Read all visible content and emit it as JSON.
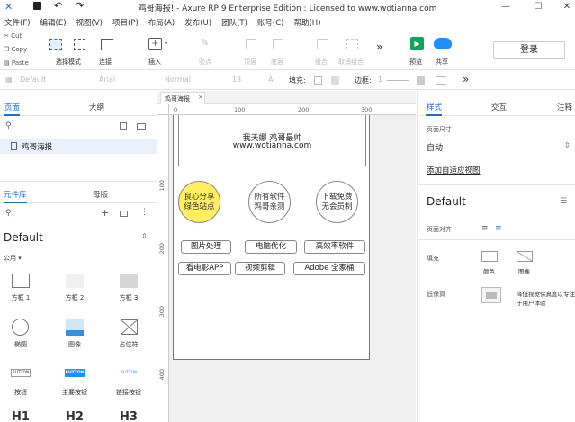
{
  "title_bar": {
    "title": "鸡哥海报! - Axure RP 9 Enterprise Edition : Licensed to www.wotianna.com",
    "minimize": "—",
    "maximize": "☐",
    "close": "✕"
  },
  "menu": [
    "文件(F)",
    "编辑(E)",
    "视图(V)",
    "项目(P)",
    "布局(A)",
    "发布(U)",
    "团队(T)",
    "账号(C)",
    "帮助(H)"
  ],
  "clipboard": {
    "cut": "Cut",
    "copy": "Copy",
    "paste": "Paste"
  },
  "toolbar": {
    "select_mode": "选择模式",
    "connect": "连接",
    "insert": "插入",
    "point": "验点",
    "top": "顶层",
    "bottom": "底层",
    "group": "组合",
    "ungroup": "取消组合",
    "more": "»",
    "preview": "预览",
    "share": "共享",
    "login": "登录"
  },
  "format_bar": {
    "style": "Default",
    "font": "Arial",
    "weight": "Normal",
    "size": "13",
    "fill_label": "填充:",
    "border_label": "边框:",
    "border_value": "1",
    "more": "»"
  },
  "pages_panel": {
    "tabs": [
      "页面",
      "大纲"
    ],
    "page_item": "鸡哥海报"
  },
  "library_panel": {
    "tabs": [
      "元件库",
      "母版"
    ],
    "library_name": "Default",
    "category": "公用 ▾",
    "items": [
      {
        "label": "方框 1"
      },
      {
        "label": "方框 2"
      },
      {
        "label": "方框 3"
      },
      {
        "label": "椭圆"
      },
      {
        "label": "图像"
      },
      {
        "label": "占位符"
      },
      {
        "label": "按钮",
        "inner": "BUTTON"
      },
      {
        "label": "主要按钮",
        "inner": "BUTTON"
      },
      {
        "label": "链接按钮",
        "inner": "BUTTON"
      },
      {
        "label": "H1"
      },
      {
        "label": "H2"
      },
      {
        "label": "H3"
      }
    ]
  },
  "canvas": {
    "tab": "鸡哥海报",
    "ruler_h": [
      "0",
      "100",
      "200",
      "300"
    ],
    "ruler_v": [
      "100",
      "200",
      "300",
      "400"
    ],
    "header_line1": "我天娜 鸡哥最帅",
    "header_line2": "www.wotianna.com",
    "circles": [
      {
        "line1": "良心分享",
        "line2": "绿色站点",
        "color": "#ffef5e"
      },
      {
        "line1": "所有软件",
        "line2": "鸡哥亲测",
        "color": "#ffffff"
      },
      {
        "line1": "下载免费",
        "line2": "无会员制",
        "color": "#ffffff"
      }
    ],
    "buttons_row1": [
      "图片处理",
      "电脑优化",
      "高效率软件"
    ],
    "buttons_row2": [
      "看电影APP",
      "视频剪辑",
      "Adobe 全家桶"
    ]
  },
  "right_panel": {
    "tabs": [
      "样式",
      "交互",
      "注释"
    ],
    "page_size_label": "页面尺寸",
    "page_size_value": "自动",
    "adaptive_link": "添加自适应视图",
    "style_name": "Default",
    "align_label": "页面对齐",
    "fill_label": "填充",
    "fill_color": "颜色",
    "fill_image": "图像",
    "low_fi_label": "低保真",
    "low_fi_desc1": "降低视觉保真度以专注",
    "low_fi_desc2": "于用户体验"
  },
  "colors": {
    "accent": "#1a6fd1",
    "preview_green": "#12a35a",
    "share_blue": "#1e90ff",
    "circle_yellow": "#ffef5e"
  }
}
